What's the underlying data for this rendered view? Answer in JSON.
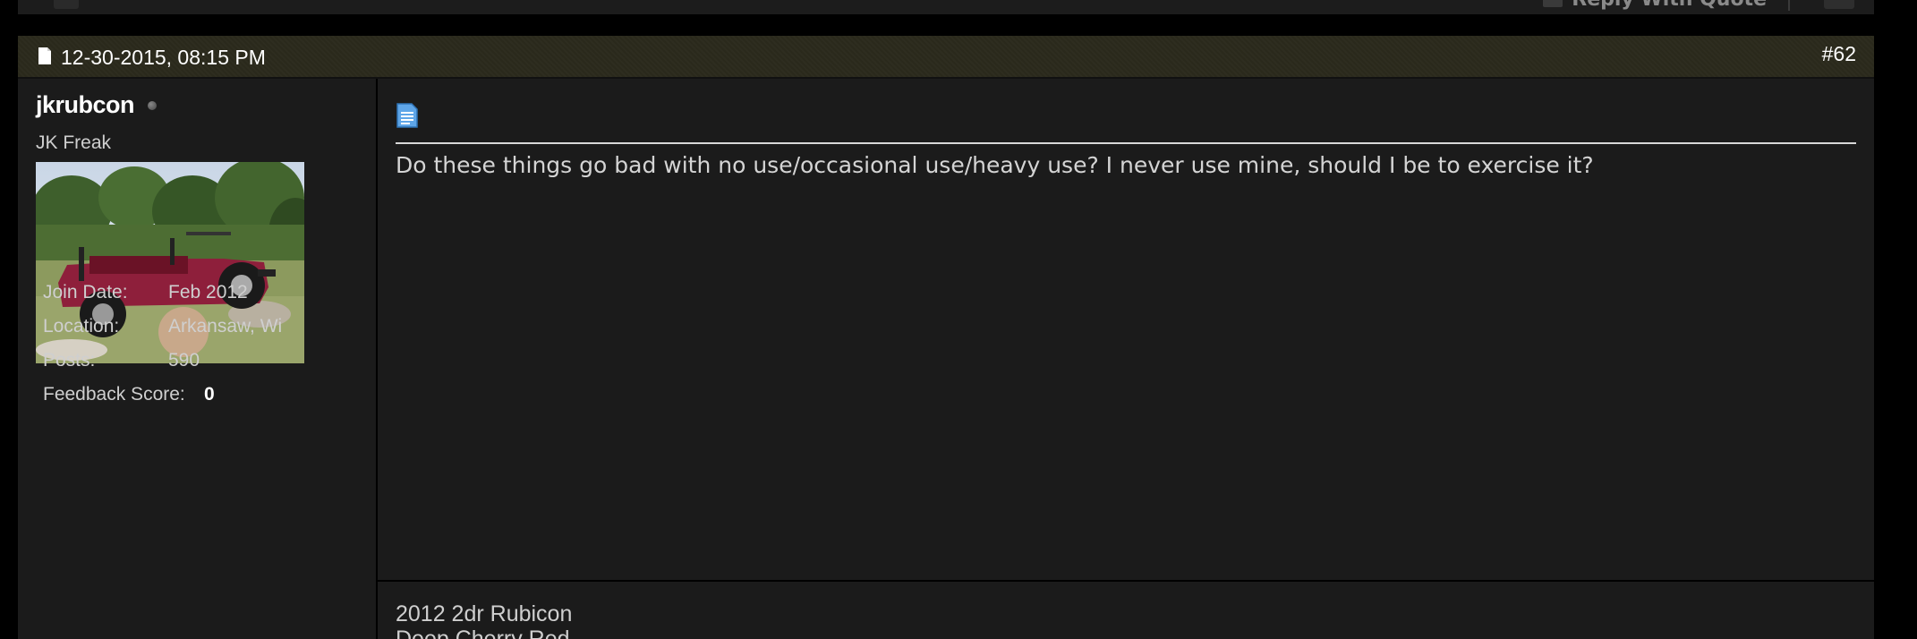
{
  "prev_post_footer": {
    "reply_with_quote_label": "Reply With Quote"
  },
  "post": {
    "date": "12-30-2015, 08:15 PM",
    "post_number": "#62",
    "author": {
      "username": "jkrubcon",
      "online_status": "offline",
      "user_title": "JK Freak",
      "avatar_alt": "Red Jeep Wrangler Rubicon on rocks",
      "info": [
        {
          "label": "Join Date:",
          "value": "Feb 2012"
        },
        {
          "label": "Location:",
          "value": "Arkansaw, Wi"
        },
        {
          "label": "Posts:",
          "value": "590"
        },
        {
          "label": "Feedback Score:",
          "value": "0"
        }
      ]
    },
    "message": "Do these things go bad with no use/occasional use/heavy use? I never use mine, should I be to exercise it?",
    "signature": [
      "2012 2dr Rubicon",
      "Deep Cherry Red"
    ]
  },
  "colors": {
    "page_bg": "#000000",
    "panel_bg": "#1b1b1b",
    "header_bg": "#2b2a1c",
    "text": "#d4d4d4",
    "username": "#ffffff"
  }
}
